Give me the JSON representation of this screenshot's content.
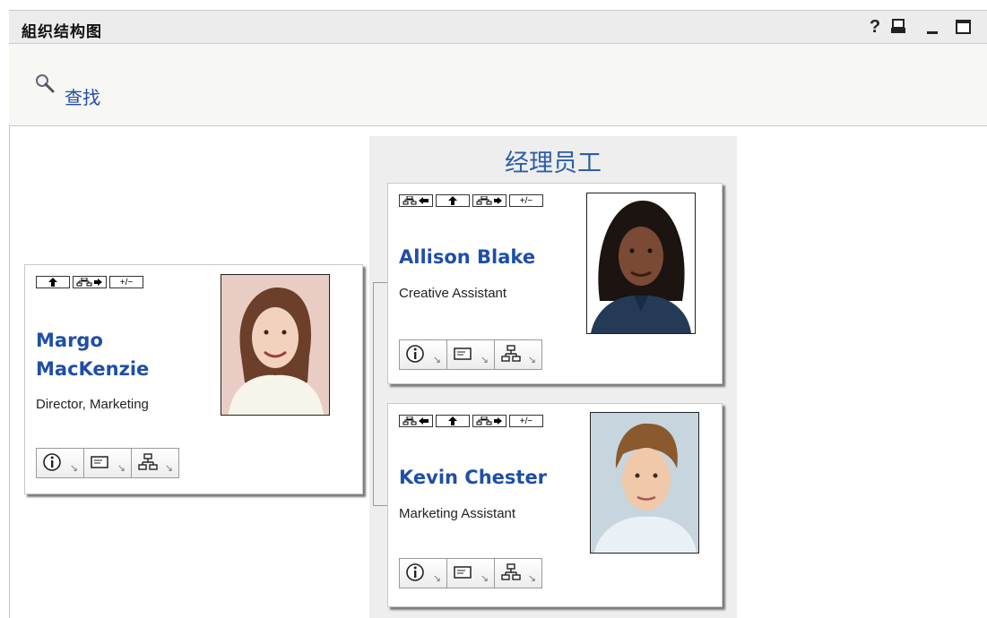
{
  "window": {
    "title": "組织结构图",
    "controls": [
      "help-icon",
      "print-icon",
      "minimize-icon",
      "maximize-icon"
    ],
    "help_label": "?"
  },
  "search": {
    "link_label": "查找",
    "icon": "magnifier-icon"
  },
  "column": {
    "title": "经理员工"
  },
  "toolbar_labels": {
    "expand_collapse": "+/−"
  },
  "manager": {
    "name_line1": "Margo",
    "name_line2": "MacKenzie",
    "job_title": "Director, Marketing"
  },
  "employees": [
    {
      "name": "Allison Blake",
      "job_title": "Creative Assistant"
    },
    {
      "name": "Kevin Chester",
      "job_title": "Marketing Assistant"
    }
  ],
  "colors": {
    "link": "#1f4ea8",
    "title_bar": "#ececec",
    "column_bg": "#eeeeee"
  }
}
